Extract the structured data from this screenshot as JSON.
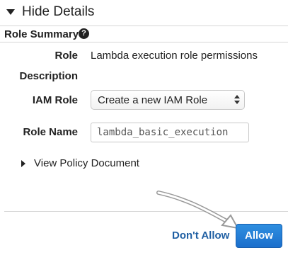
{
  "header": {
    "toggle_label": "Hide Details"
  },
  "summary": {
    "title": "Role Summary",
    "help_glyph": "?"
  },
  "fields": {
    "role_label": "Role",
    "role_value": "Lambda execution role permissions",
    "description_label": "Description",
    "iam_role_label": "IAM Role",
    "iam_role_selected": "Create a new IAM Role",
    "role_name_label": "Role Name",
    "role_name_value": "lambda_basic_execution"
  },
  "policy": {
    "link_label": "View Policy Document"
  },
  "actions": {
    "dont_allow_label": "Don't Allow",
    "allow_label": "Allow"
  },
  "icons": {
    "toggle": "caret-down-icon",
    "help": "question-circle-icon",
    "select": "select-arrows-icon",
    "policy": "caret-right-icon",
    "annotation": "annotation-arrow-icon"
  },
  "colors": {
    "link_blue": "#1f5fa3",
    "allow_button_top": "#2f8fe0",
    "allow_button_bottom": "#1b6fcc",
    "divider": "#d6d6d6"
  }
}
